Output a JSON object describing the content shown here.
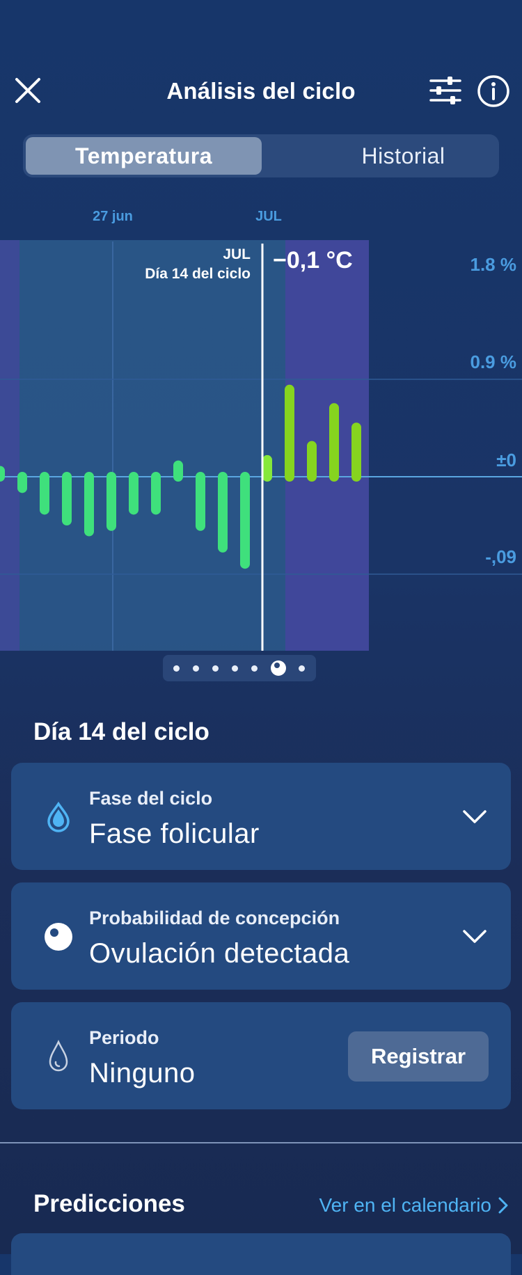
{
  "header": {
    "title": "Análisis del ciclo",
    "close_icon": "close-icon",
    "filter_icon": "sliders-icon",
    "info_icon": "info-icon"
  },
  "tabs": [
    {
      "label": "Temperatura",
      "active": true
    },
    {
      "label": "Historial",
      "active": false
    }
  ],
  "chart": {
    "top_labels": {
      "left": "27 jun",
      "right": "JUL"
    },
    "cursor_label_month": "JUL",
    "cursor_label_day": "Día 14 del ciclo",
    "cursor_value": "−0,1 °C",
    "y_labels": [
      "1.8 %",
      "0.9 %",
      "±0",
      "-,09"
    ]
  },
  "chart_data": {
    "type": "bar",
    "title": "",
    "xlabel": "",
    "ylabel": "",
    "ylim": [
      -0.16,
      0.24
    ],
    "y_ticks": [
      "1.8 %",
      "0.9 %",
      "±0",
      "-,09"
    ],
    "x_labels": [
      "27 jun",
      "JUL"
    ],
    "series": [
      {
        "values": [
          0.01,
          -0.015,
          -0.035,
          -0.045,
          -0.055,
          -0.05,
          -0.035,
          -0.035,
          0.015,
          -0.05,
          -0.07,
          -0.085,
          0.02,
          0.085,
          0.033,
          0.068,
          0.05
        ]
      }
    ],
    "selected_index": 12,
    "pager_pages": 7,
    "pager_active": 5
  },
  "colors": {
    "accent": "#4fb4f4",
    "bar_low": "#3ee07a",
    "bar_high": "#8ee428",
    "phase_follicular": "#2f5d8f",
    "phase_ovulation": "#41479a"
  },
  "selected_day": {
    "heading": "Día 14 del ciclo"
  },
  "cards": {
    "phase": {
      "label": "Fase del ciclo",
      "value": "Fase folicular",
      "icon": "drop-icon"
    },
    "conception": {
      "label": "Probabilidad de concepción",
      "value": "Ovulación detectada",
      "icon": "ovulation-icon"
    },
    "period": {
      "label": "Periodo",
      "value": "Ninguno",
      "icon": "drop-outline-icon",
      "button": "Registrar"
    }
  },
  "predictions": {
    "heading": "Predicciones",
    "link": "Ver en el calendario"
  }
}
